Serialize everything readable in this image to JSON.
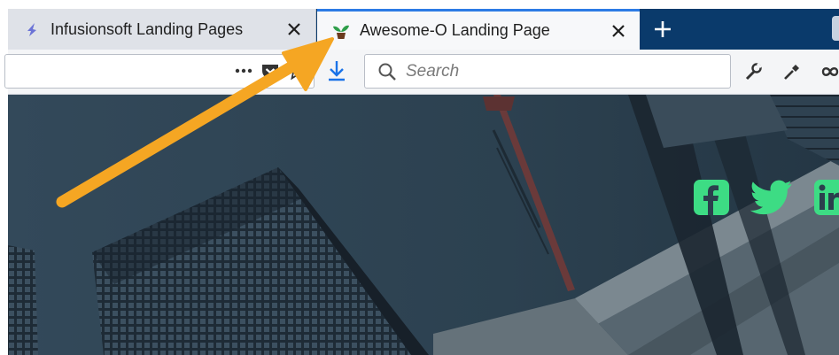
{
  "tabs": [
    {
      "label": "Infusionsoft Landing Pages",
      "active": false,
      "icon": "infusionsoft-favicon-icon"
    },
    {
      "label": "Awesome-O Landing Page",
      "active": true,
      "icon": "sprout-favicon-icon"
    }
  ],
  "toolbar": {
    "search_placeholder": "Search",
    "tools": [
      "wrench-icon",
      "eyedropper-icon",
      "infinity-icon"
    ]
  },
  "content": {
    "social": [
      "facebook-icon",
      "twitter-icon",
      "linkedin-icon"
    ]
  },
  "colors": {
    "tabstrip": "#0a3a6b",
    "active_tab_accent": "#2c7be5",
    "download_blue": "#1a73e8",
    "social_green": "#3ddc84",
    "arrow_orange": "#f5a623",
    "page_background": "#2b3f4d"
  }
}
